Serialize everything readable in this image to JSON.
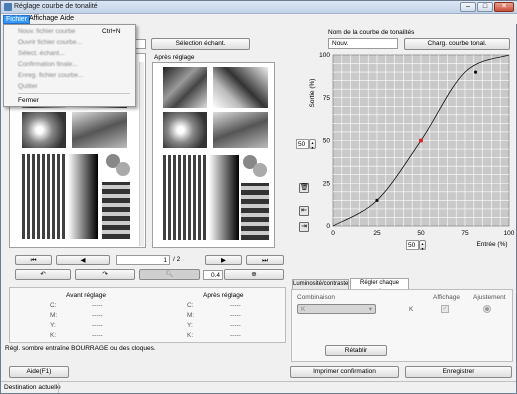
{
  "window": {
    "title": "Réglage courbe de tonalité",
    "min": "–",
    "max": "□",
    "close": "✕"
  },
  "menubar": {
    "file": "Fichier",
    "view": "Affichage",
    "help": "Aide"
  },
  "file_menu": {
    "items": [
      "Nouv. fichier courbe",
      "Ouvrir fichier courbe...",
      "Sélect. échant...",
      "Confirmation finale...",
      "Enreg. fichier courbe...",
      "Quitter"
    ],
    "shortcut": "Ctrl+N",
    "close": "Fermer"
  },
  "sample": {
    "button": "Sélection échant.",
    "field": ""
  },
  "before_panel": {
    "label": ""
  },
  "after_panel": {
    "label": "Après réglage"
  },
  "pager": {
    "current": "1",
    "total": "/ 2"
  },
  "zoom": {
    "value": "0.4"
  },
  "comparison": {
    "before_title": "Avant réglage",
    "after_title": "Après réglage",
    "channels": [
      "C:",
      "M:",
      "Y:",
      "K:"
    ],
    "before_values": [
      "-----",
      "-----",
      "-----",
      "-----"
    ],
    "after_values": [
      "-----",
      "-----",
      "-----",
      "-----"
    ]
  },
  "message": "Régl. sombre entraîne BOURRAGE ou des cloques.",
  "curve": {
    "name_label": "Nom de la courbe de tonalités",
    "name_value": "Nouv.",
    "load_button": "Charg. courbe tonal.",
    "output_axis": "Sortie (%)",
    "input_axis": "Entrée (%)",
    "output_value": "50",
    "input_value": "50",
    "accent": "#e02020"
  },
  "chart_data": {
    "type": "line",
    "x": [
      0,
      25,
      50,
      75,
      100
    ],
    "y": [
      0,
      15,
      50,
      90,
      100
    ],
    "control_points": [
      {
        "x": 25,
        "y": 15
      },
      {
        "x": 50,
        "y": 50
      },
      {
        "x": 81,
        "y": 90
      }
    ],
    "selected_point": {
      "x": 50,
      "y": 50
    },
    "xlabel": "Entrée (%)",
    "ylabel": "Sortie (%)",
    "xlim": [
      0,
      100
    ],
    "ylim": [
      0,
      100
    ],
    "xticks": [
      "0",
      "25",
      "50",
      "75",
      "100"
    ],
    "yticks": [
      "0",
      "25",
      "50",
      "75",
      "100"
    ],
    "grid": true
  },
  "tabs": {
    "brightness": "Luminosité/contraste",
    "each_color": "Régler chaque couleur"
  },
  "color_group": {
    "combination_label": "Combinaison",
    "combination_value": "K",
    "k_label": "K",
    "display_label": "Affichage",
    "adjust_label": "Ajustement",
    "reset_button": "Rétablir"
  },
  "bottom": {
    "help": "Aide(F1)",
    "print_confirm": "Imprimer confirmation",
    "save": "Enregistrer",
    "status": "Destination actuelle"
  }
}
